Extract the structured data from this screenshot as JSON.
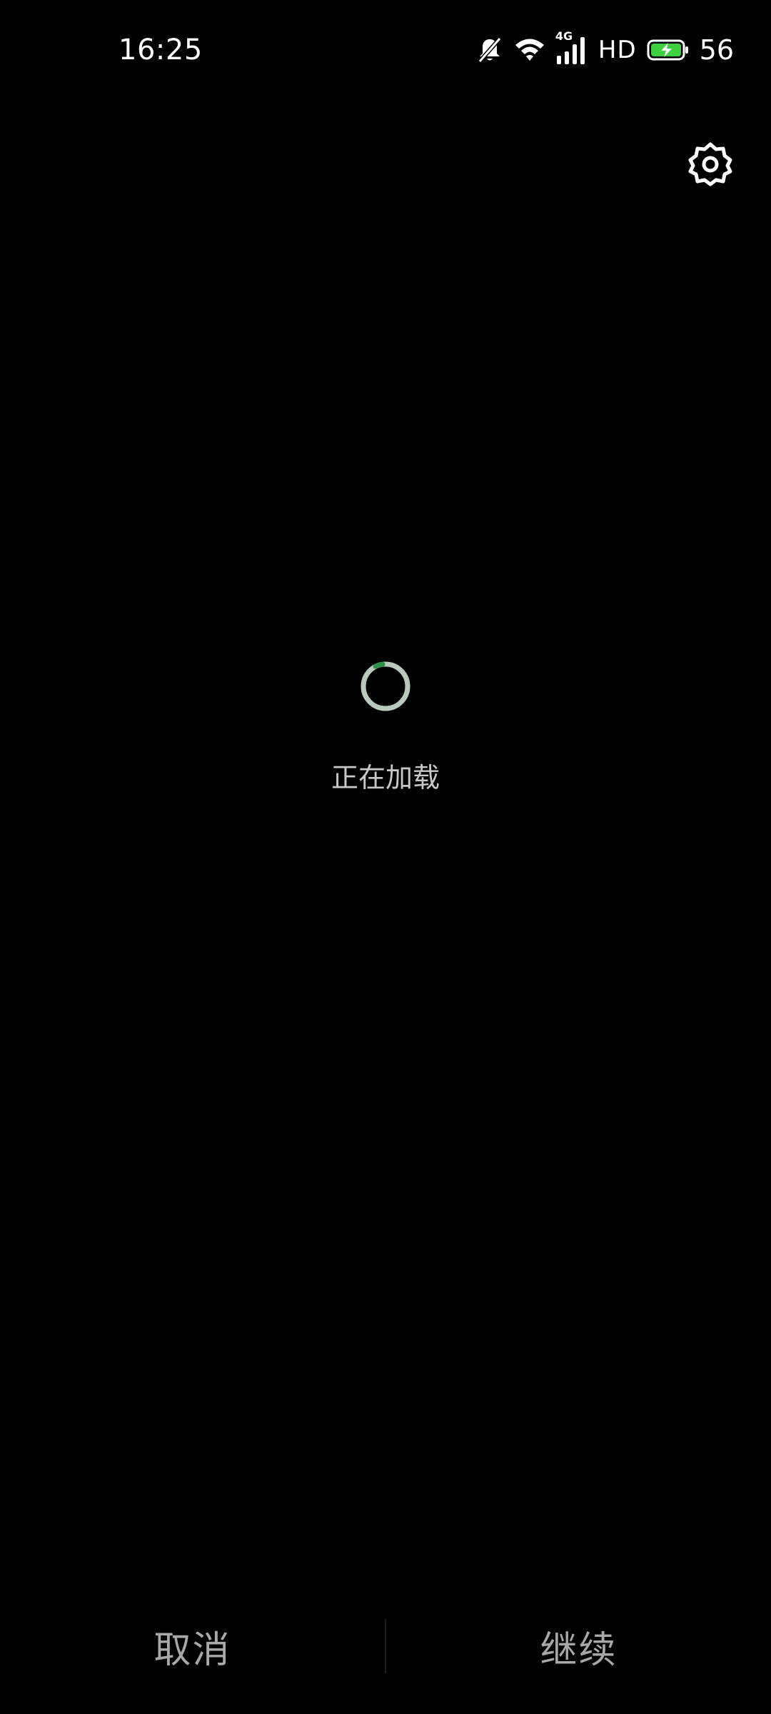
{
  "status_bar": {
    "time": "16:25",
    "network_type": "4G",
    "hd_label": "HD",
    "battery_level": "56",
    "icons": [
      "bell-muted-icon",
      "wifi-icon",
      "cellular-signal-icon",
      "battery-charging-icon"
    ],
    "battery_color": "#3ed03e"
  },
  "settings": {
    "icon": "gear-icon"
  },
  "loading": {
    "text": "正在加载",
    "spinner_color": "#b9c9bc",
    "spinner_accent": "#2e8f4a"
  },
  "actions": {
    "cancel_label": "取消",
    "continue_label": "继续"
  }
}
